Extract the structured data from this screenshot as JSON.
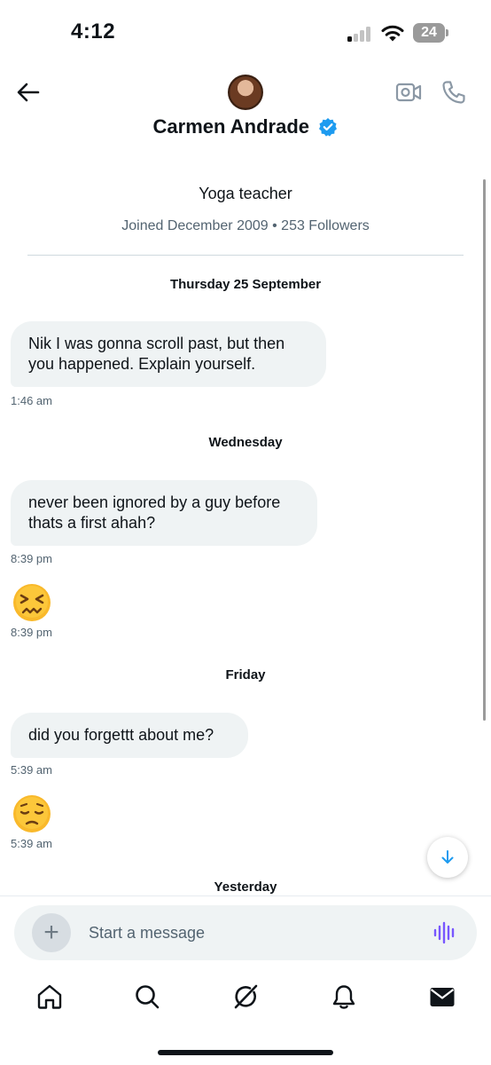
{
  "status_bar": {
    "time": "4:12",
    "battery": "24"
  },
  "header": {
    "contact_name": "Carmen Andrade",
    "verified": true
  },
  "profile": {
    "bio": "Yoga teacher",
    "joined": "Joined December 2009 • 253 Followers"
  },
  "conversation": [
    {
      "date": "Thursday 25 September",
      "messages": [
        {
          "text": "Nik I was gonna scroll past, but then you happened. Explain yourself.",
          "time": "1:46 am"
        }
      ]
    },
    {
      "date": "Wednesday",
      "messages": [
        {
          "text": "never been ignored by a guy before thats a first ahah?",
          "time": "8:39 pm"
        },
        {
          "emoji": "confounded-face",
          "time": "8:39 pm"
        }
      ]
    },
    {
      "date": "Friday",
      "messages": [
        {
          "text": "did you forgettt about me?",
          "time": "5:39 am"
        },
        {
          "emoji": "pensive-face",
          "time": "5:39 am"
        }
      ]
    },
    {
      "date": "Yesterday",
      "messages": []
    }
  ],
  "composer": {
    "placeholder": "Start a message",
    "value": ""
  },
  "nav": [
    "home-icon",
    "search-icon",
    "grok-icon",
    "notifications-icon",
    "messages-icon"
  ],
  "colors": {
    "accent": "#1d9bf0",
    "verified": "#1d9bf0",
    "voice": "#7856ff",
    "bubble": "#eff3f4",
    "secondary_text": "#536471"
  }
}
